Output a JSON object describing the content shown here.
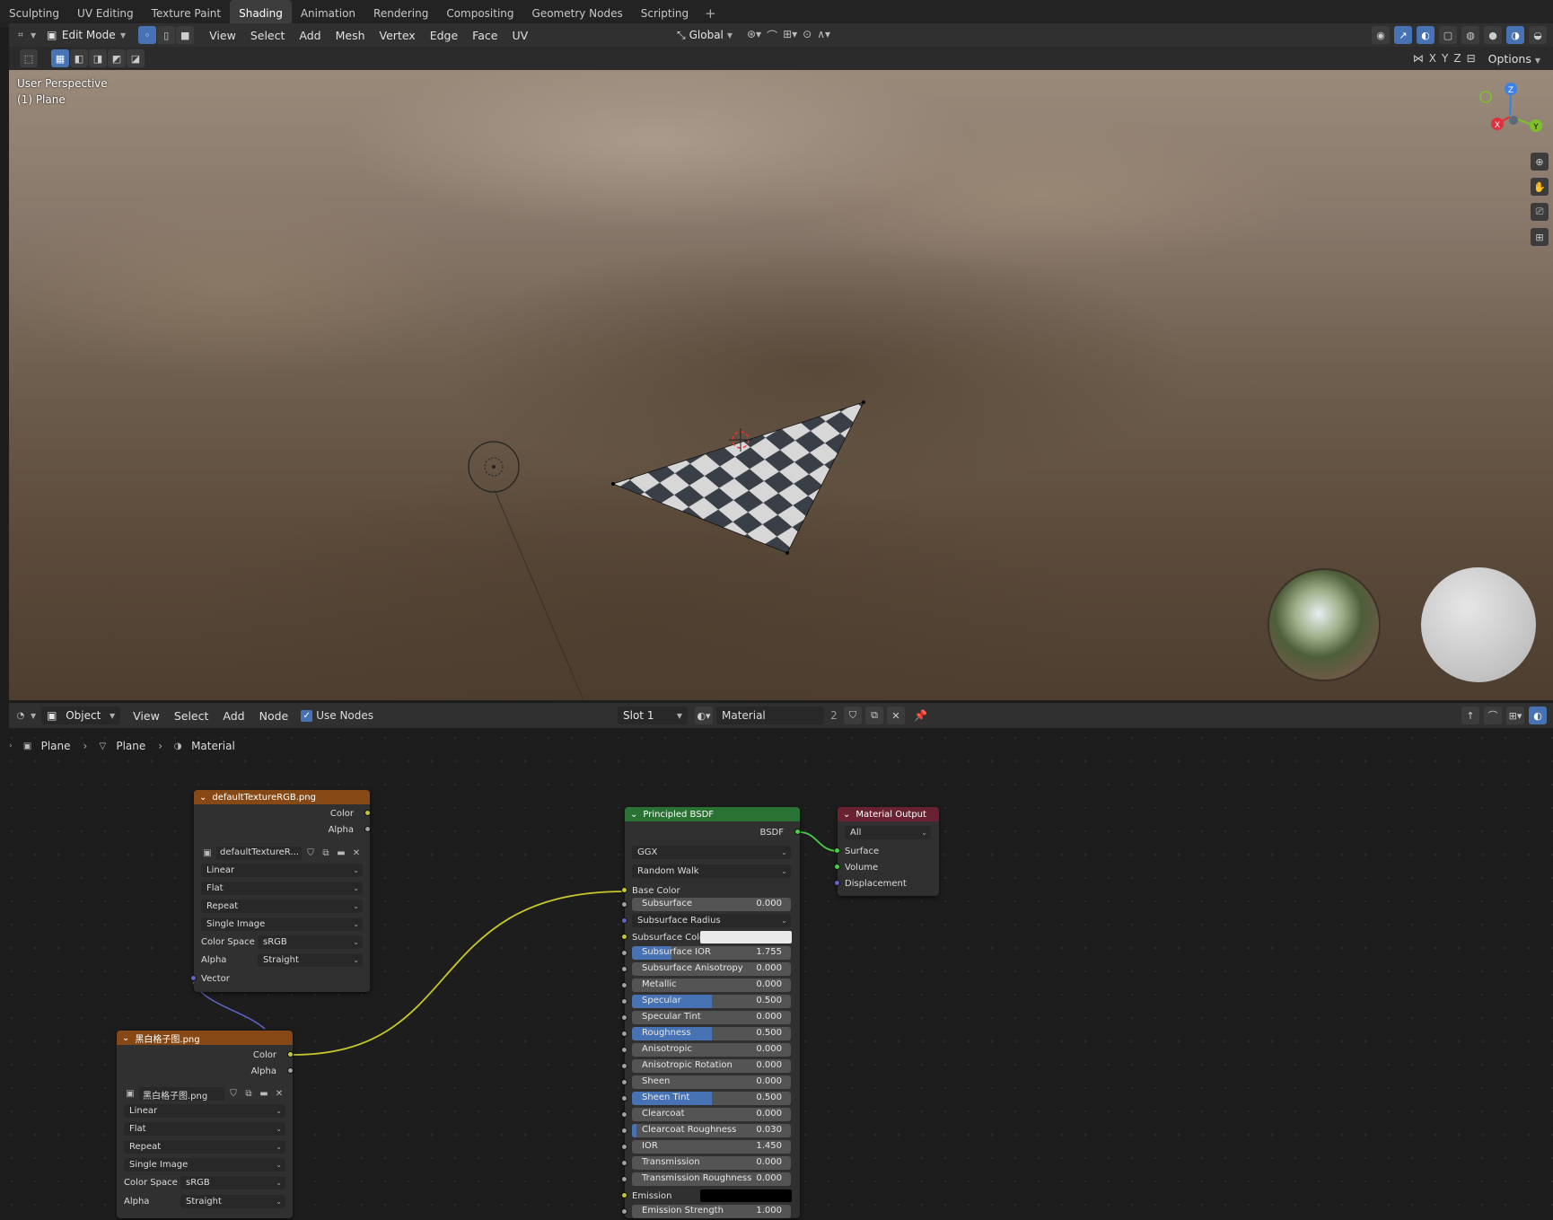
{
  "workspace_tabs": [
    "Sculpting",
    "UV Editing",
    "Texture Paint",
    "Shading",
    "Animation",
    "Rendering",
    "Compositing",
    "Geometry Nodes",
    "Scripting"
  ],
  "active_tab": "Shading",
  "viewport": {
    "mode": "Edit Mode",
    "menus": [
      "View",
      "Select",
      "Add",
      "Mesh",
      "Vertex",
      "Edge",
      "Face",
      "UV"
    ],
    "transform_orientation": "Global",
    "options_label": "Options",
    "axis_x": "X",
    "axis_y": "Y",
    "axis_z": "Z",
    "overlay_line1": "User Perspective",
    "overlay_line2": "(1) Plane",
    "gizmo": {
      "x": "X",
      "y": "Y",
      "z": "Z"
    }
  },
  "node_editor": {
    "type_label": "Object",
    "menus": [
      "View",
      "Select",
      "Add",
      "Node"
    ],
    "use_nodes_label": "Use Nodes",
    "slot": "Slot 1",
    "material_name": "Material",
    "user_count": "2",
    "breadcrumb": [
      "Plane",
      "Plane",
      "Material"
    ]
  },
  "node_texture1": {
    "title": "defaultTextureRGB.png",
    "out_color": "Color",
    "out_alpha": "Alpha",
    "image_name": "defaultTextureR...",
    "interpolation": "Linear",
    "projection": "Flat",
    "extension": "Repeat",
    "source": "Single Image",
    "color_space_label": "Color Space",
    "color_space": "sRGB",
    "alpha_label": "Alpha",
    "alpha_mode": "Straight",
    "in_vector": "Vector"
  },
  "node_texture2": {
    "title": "黑白格子图.png",
    "out_color": "Color",
    "out_alpha": "Alpha",
    "image_name": "黑白格子图.png",
    "interpolation": "Linear",
    "projection": "Flat",
    "extension": "Repeat",
    "source": "Single Image",
    "color_space_label": "Color Space",
    "color_space": "sRGB",
    "alpha_label": "Alpha",
    "alpha_mode": "Straight"
  },
  "node_bsdf": {
    "title": "Principled BSDF",
    "out_bsdf": "BSDF",
    "distribution": "GGX",
    "subsurface_method": "Random Walk",
    "base_color_label": "Base Color",
    "subsurface_radius_label": "Subsurface Radius",
    "subsurface_color_label": "Subsurface Color",
    "emission_label": "Emission",
    "params": [
      {
        "label": "Subsurface",
        "value": "0.000",
        "fill": 0
      },
      {
        "label": "Subsurface IOR",
        "value": "1.755",
        "fill": 0.25
      },
      {
        "label": "Subsurface Anisotropy",
        "value": "0.000",
        "fill": 0
      },
      {
        "label": "Metallic",
        "value": "0.000",
        "fill": 0
      },
      {
        "label": "Specular",
        "value": "0.500",
        "fill": 0.5
      },
      {
        "label": "Specular Tint",
        "value": "0.000",
        "fill": 0
      },
      {
        "label": "Roughness",
        "value": "0.500",
        "fill": 0.5
      },
      {
        "label": "Anisotropic",
        "value": "0.000",
        "fill": 0
      },
      {
        "label": "Anisotropic Rotation",
        "value": "0.000",
        "fill": 0
      },
      {
        "label": "Sheen",
        "value": "0.000",
        "fill": 0
      },
      {
        "label": "Sheen Tint",
        "value": "0.500",
        "fill": 0.5
      },
      {
        "label": "Clearcoat",
        "value": "0.000",
        "fill": 0
      },
      {
        "label": "Clearcoat Roughness",
        "value": "0.030",
        "fill": 0.03
      },
      {
        "label": "IOR",
        "value": "1.450",
        "fill": 0
      },
      {
        "label": "Transmission",
        "value": "0.000",
        "fill": 0
      },
      {
        "label": "Transmission Roughness",
        "value": "0.000",
        "fill": 0
      }
    ],
    "emission_strength_label": "Emission Strength",
    "emission_strength": "1.000"
  },
  "node_output": {
    "title": "Material Output",
    "target": "All",
    "inputs": [
      "Surface",
      "Volume",
      "Displacement"
    ]
  },
  "colors": {
    "accent": "#4772b3",
    "image_node_header": "#864916",
    "shader_node_header": "#2a7134",
    "output_node_header": "#6a2232"
  }
}
